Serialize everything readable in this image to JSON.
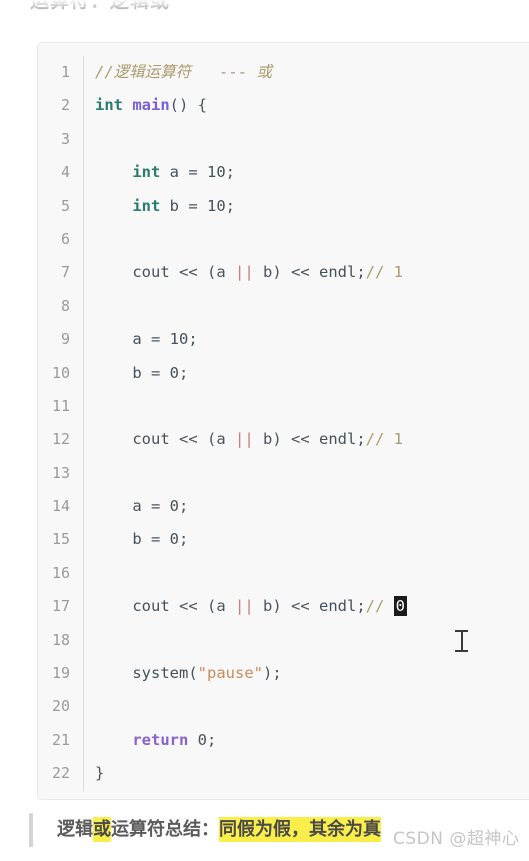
{
  "page": {
    "heading": "运算符：逻辑或",
    "background_color": "#ffffff"
  },
  "code_block": {
    "language": "cpp",
    "background_color": "#f8f8f8",
    "border_color": "#e8e8e8",
    "line_number_color": "#9a9a9a",
    "line_numbers": [
      "1",
      "2",
      "3",
      "4",
      "5",
      "6",
      "7",
      "8",
      "9",
      "10",
      "11",
      "12",
      "13",
      "14",
      "15",
      "16",
      "17",
      "18",
      "19",
      "20",
      "21",
      "22"
    ],
    "lines": [
      {
        "n": "1",
        "text": "//逻辑运算符   --- 或"
      },
      {
        "n": "2",
        "text": "int main() {"
      },
      {
        "n": "3",
        "text": ""
      },
      {
        "n": "4",
        "text": "    int a = 10;"
      },
      {
        "n": "5",
        "text": "    int b = 10;"
      },
      {
        "n": "6",
        "text": ""
      },
      {
        "n": "7",
        "text": "    cout << (a || b) << endl;// 1"
      },
      {
        "n": "8",
        "text": ""
      },
      {
        "n": "9",
        "text": "    a = 10;"
      },
      {
        "n": "10",
        "text": "    b = 0;"
      },
      {
        "n": "11",
        "text": ""
      },
      {
        "n": "12",
        "text": "    cout << (a || b) << endl;// 1"
      },
      {
        "n": "13",
        "text": ""
      },
      {
        "n": "14",
        "text": "    a = 0;"
      },
      {
        "n": "15",
        "text": "    b = 0;"
      },
      {
        "n": "16",
        "text": ""
      },
      {
        "n": "17",
        "text": "    cout << (a || b) << endl;// 0"
      },
      {
        "n": "18",
        "text": ""
      },
      {
        "n": "19",
        "text": "    system(\"pause\");"
      },
      {
        "n": "20",
        "text": ""
      },
      {
        "n": "21",
        "text": "    return 0;"
      },
      {
        "n": "22",
        "text": "}"
      }
    ],
    "tokens": {
      "l1_comment": "//逻辑运算符   --- 或",
      "l2_kw": "int",
      "l2_fn": "main",
      "l2_punc": "() {",
      "l4_kw": "int",
      "l4_var": " a ",
      "l4_eq": "= ",
      "l4_num": "10",
      "l4_semi": ";",
      "l5_kw": "int",
      "l5_var": " b ",
      "l5_eq": "= ",
      "l5_num": "10",
      "l5_semi": ";",
      "l7_cout": "cout ",
      "l7_shift1": "<< ",
      "l7_paren_open": "(a ",
      "l7_or": "||",
      "l7_paren_close": " b) ",
      "l7_shift2": "<< ",
      "l7_endl": "endl;",
      "l7_comment": "// 1",
      "l9_var": "a ",
      "l9_eq": "= ",
      "l9_num": "10",
      "l9_semi": ";",
      "l10_var": "b ",
      "l10_eq": "= ",
      "l10_num": "0",
      "l10_semi": ";",
      "l12_comment": "// 1",
      "l14_var": "a ",
      "l14_eq": "= ",
      "l14_num": "0",
      "l14_semi": ";",
      "l15_var": "b ",
      "l15_eq": "= ",
      "l15_num": "0",
      "l15_semi": ";",
      "l17_comment_slashes": "// ",
      "l17_selected_char": "0",
      "l19_fn": "system",
      "l19_paren_open": "(",
      "l19_str": "\"pause\"",
      "l19_paren_close": ");",
      "l21_ret": "return",
      "l21_num": " 0",
      "l21_semi": ";",
      "l22_brace": "}"
    },
    "syntax_colors": {
      "comment": "#ab9b6b",
      "keyword": "#2a7c6f",
      "function": "#7a5fd6",
      "return_keyword": "#8a63c9",
      "operator_or": "#c97a7a",
      "string": "#c98a5e",
      "identifier": "#44525c",
      "selection_bg": "#1b1b1b",
      "selection_fg": "#ffffff"
    }
  },
  "summary": {
    "prefix": "逻辑",
    "highlight_word": "或",
    "middle": "运算符总结：",
    "highlight_conclusion": "同假为假，其余为真",
    "highlight_color": "#faee4a",
    "bar_color": "#d4d4d4"
  },
  "watermark": {
    "text": "CSDN @超神心"
  }
}
